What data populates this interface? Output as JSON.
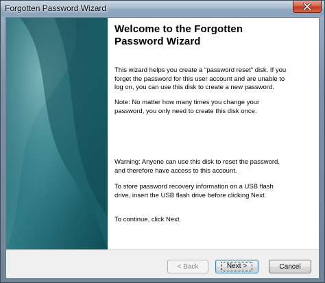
{
  "window": {
    "title": "Forgotten Password Wizard"
  },
  "wizard": {
    "heading_line1": "Welcome to the Forgotten",
    "heading_line2": "Password Wizard",
    "paragraphs": [
      [
        "This wizard helps you create a \"password reset\" disk. If you",
        "forget the password for this user account and are unable to",
        "log on, you can use this disk to create a new password."
      ],
      [
        "Note: No matter how many times you change your",
        "password, you only need to create this disk once."
      ],
      [
        "Warning: Anyone can use this disk to reset the password,",
        "and therefore have access to this account."
      ],
      [
        "To store password recovery information on a USB flash",
        "drive, insert the USB flash drive before clicking Next."
      ],
      [
        "To continue, click Next."
      ]
    ]
  },
  "buttons": {
    "back_label": "< Back",
    "next_label": "Next >",
    "cancel_label": "Cancel"
  },
  "colors": {
    "banner_dark": "#0b4a54",
    "banner_mid": "#2f7c86",
    "banner_light": "#5fa6ad",
    "close_red": "#c2391f"
  }
}
